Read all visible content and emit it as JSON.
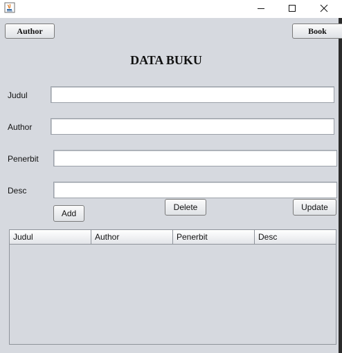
{
  "window": {
    "minimize_icon": "minimize-icon",
    "maximize_icon": "maximize-icon",
    "close_icon": "close-icon",
    "app_icon": "java-icon"
  },
  "nav": {
    "author_label": "Author",
    "book_label": "Book"
  },
  "heading": "DATA BUKU",
  "form": {
    "judul_label": "Judul",
    "author_label": "Author",
    "penerbit_label": "Penerbit",
    "desc_label": "Desc",
    "judul_value": "",
    "author_value": "",
    "penerbit_value": "",
    "desc_value": ""
  },
  "actions": {
    "add_label": "Add",
    "delete_label": "Delete",
    "update_label": "Update"
  },
  "table": {
    "columns": [
      "Judul",
      "Author",
      "Penerbit",
      "Desc"
    ],
    "rows": []
  },
  "colors": {
    "panel_bg": "#d6d9df",
    "titlebar_bg": "#ffffff"
  }
}
